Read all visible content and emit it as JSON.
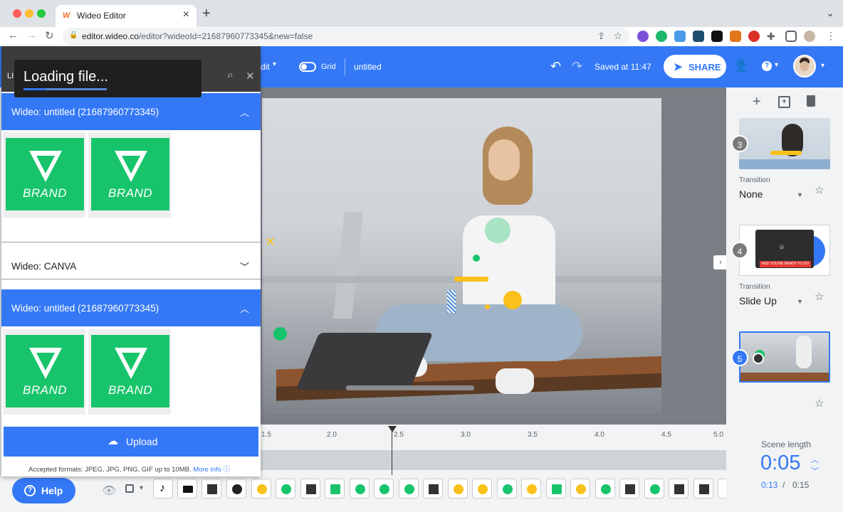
{
  "browser": {
    "tab_title": "Wideo Editor",
    "url_host": "editor.wideo.co",
    "url_path": "/editor?wideoId=21687960773345&new=false",
    "close": "×",
    "newtab": "+"
  },
  "header": {
    "edit_label": "dit",
    "grid_label": "Grid",
    "project_title": "untitled",
    "saved_text": "Saved at 11:47",
    "share_label": "SHARE"
  },
  "library": {
    "panel_label": "LI",
    "toast": "Loading file...",
    "groups": [
      {
        "title": "Wideo: untitled (21687960773345)",
        "expanded": true
      },
      {
        "title": "Wideo: CANVA",
        "expanded": false
      },
      {
        "title": "Wideo: untitled (21687960773345)",
        "expanded": true
      }
    ],
    "brand_text": "BRAND",
    "upload_label": "Upload",
    "formats_text": "Accepted formats: JPEG, JPG, PNG, GIF up to 10MB.",
    "more_info": "More info"
  },
  "scenes": [
    {
      "number": "3",
      "transition_label": "Transition",
      "transition": "None"
    },
    {
      "number": "4",
      "transition_label": "Transition",
      "transition": "Slide Up",
      "caption": "AND YOU'RE READY TO GO"
    },
    {
      "number": "5"
    }
  ],
  "timeline": {
    "ticks": [
      "1.5",
      "2.0",
      "2.5",
      "3.0",
      "3.5",
      "4.0",
      "4.5",
      "5.0"
    ]
  },
  "scene_length": {
    "label": "Scene length",
    "value": "0:05",
    "current": "0:13",
    "separator": "/",
    "total": "0:15"
  },
  "help": {
    "label": "Help"
  },
  "colors": {
    "accent": "#3478f6",
    "green": "#18c46b",
    "yellow": "#f9c11a"
  }
}
